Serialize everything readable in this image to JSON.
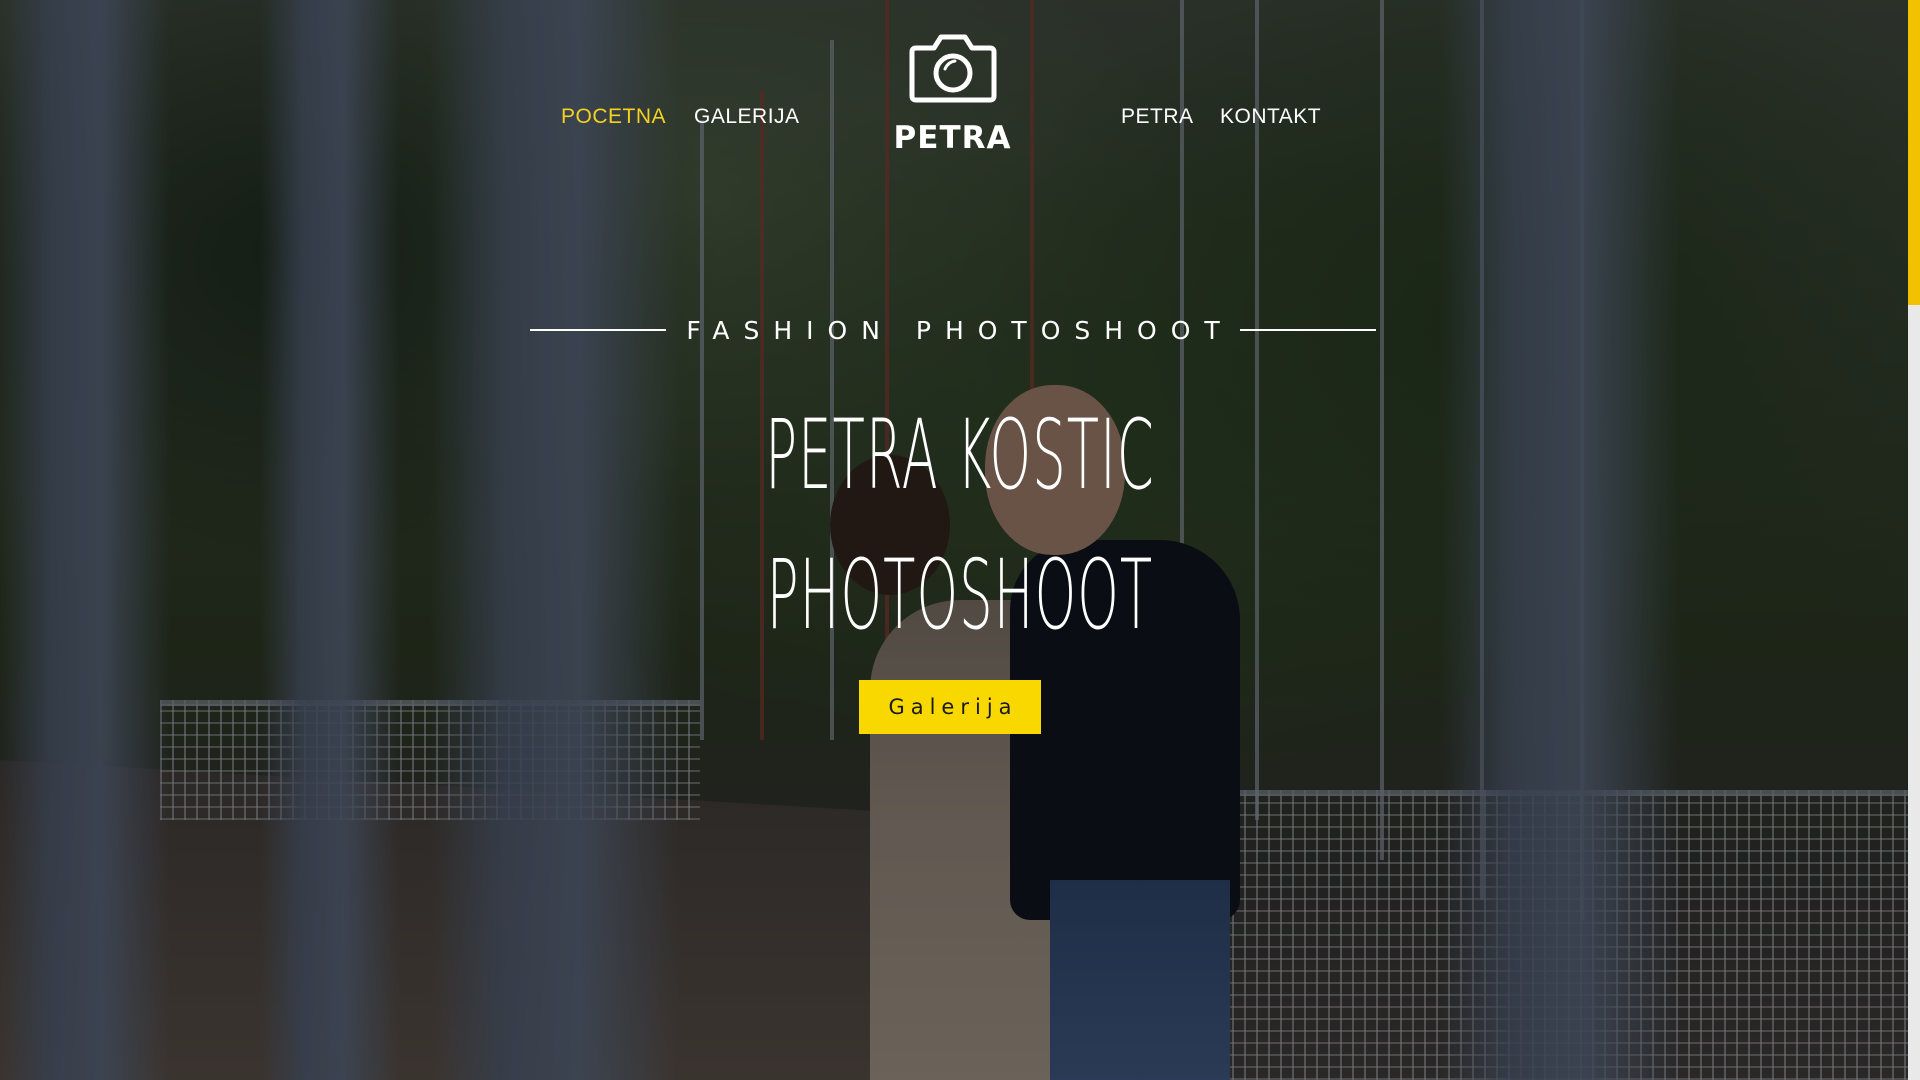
{
  "nav": {
    "left": [
      {
        "label": "POCETNA",
        "active": true
      },
      {
        "label": "GALERIJA",
        "active": false
      }
    ],
    "right": [
      {
        "label": "PETRA",
        "active": false
      },
      {
        "label": "KONTAKT",
        "active": false
      }
    ],
    "logo": {
      "text": "PETRA",
      "icon": "camera-icon"
    }
  },
  "hero": {
    "tagline": "FASHION PHOTOSHOOT",
    "headline": [
      "PETRA KOSTIC",
      "PHOTOSHOOT"
    ],
    "cta_label": "Galerija"
  },
  "colors": {
    "accent": "#f9d800",
    "active_nav": "#f4d21f",
    "text": "#ffffff"
  }
}
